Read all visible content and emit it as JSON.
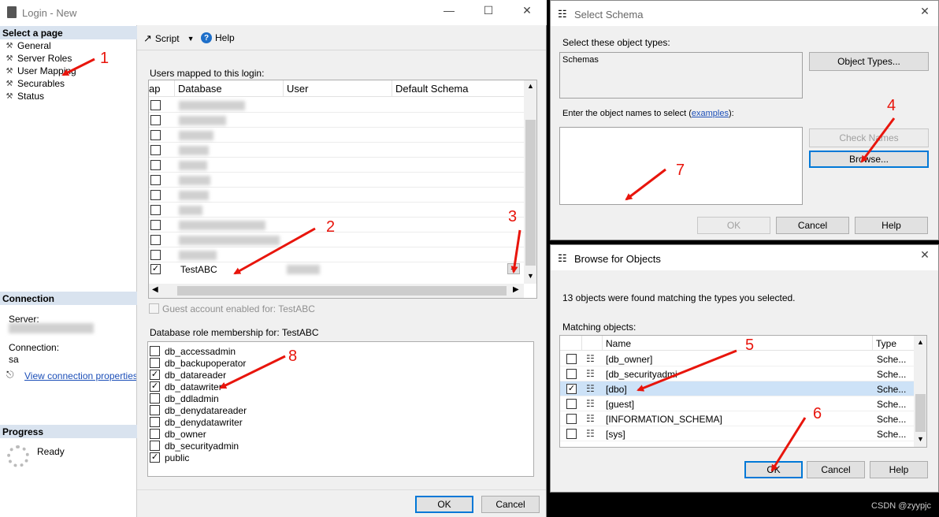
{
  "login": {
    "title": "Login - New",
    "pages_header": "Select a page",
    "pages": [
      "General",
      "Server Roles",
      "User Mapping",
      "Securables",
      "Status"
    ],
    "connection_header": "Connection",
    "server_label": "Server:",
    "connection_label": "Connection:",
    "connection_value": "sa",
    "view_connection_link": "View connection properties",
    "progress_header": "Progress",
    "progress_status": "Ready",
    "toolbar": {
      "script": "Script",
      "help": "Help"
    },
    "users_mapped_label": "Users mapped to this login:",
    "mapping_columns": [
      "ap",
      "Database",
      "User",
      "Default Schema"
    ],
    "mapping_last_db": "TestABC",
    "guest_label": "Guest account enabled for: TestABC",
    "role_membership_label": "Database role membership for: TestABC",
    "roles": [
      {
        "name": "db_accessadmin",
        "checked": false
      },
      {
        "name": "db_backupoperator",
        "checked": false
      },
      {
        "name": "db_datareader",
        "checked": true
      },
      {
        "name": "db_datawriter",
        "checked": true
      },
      {
        "name": "db_ddladmin",
        "checked": false
      },
      {
        "name": "db_denydatareader",
        "checked": false
      },
      {
        "name": "db_denydatawriter",
        "checked": false
      },
      {
        "name": "db_owner",
        "checked": false
      },
      {
        "name": "db_securityadmin",
        "checked": false
      },
      {
        "name": "public",
        "checked": true
      }
    ],
    "ok": "OK",
    "cancel": "Cancel",
    "ellipsis_button": "..."
  },
  "schema_dialog": {
    "title": "Select Schema",
    "object_types_label": "Select these object types:",
    "object_types_value": "Schemas",
    "object_types_button": "Object Types...",
    "enter_names_label": "Enter the object names to select (",
    "examples_link": "examples",
    "enter_names_suffix": "):",
    "check_names_button": "Check Names",
    "browse_button": "Browse...",
    "ok": "OK",
    "cancel": "Cancel",
    "help": "Help"
  },
  "browse_dialog": {
    "title": "Browse for Objects",
    "found_text": "13 objects were found matching the types you selected.",
    "matching_label": "Matching objects:",
    "columns": [
      "Name",
      "Type"
    ],
    "rows": [
      {
        "name": "[db_owner]",
        "type": "Sche...",
        "checked": false
      },
      {
        "name": "[db_securityadmi",
        "type": "Sche...",
        "checked": false
      },
      {
        "name": "[dbo]",
        "type": "Sche...",
        "checked": true
      },
      {
        "name": "[guest]",
        "type": "Sche...",
        "checked": false
      },
      {
        "name": "[INFORMATION_SCHEMA]",
        "type": "Sche...",
        "checked": false
      },
      {
        "name": "[sys]",
        "type": "Sche...",
        "checked": false
      }
    ],
    "ok": "OK",
    "cancel": "Cancel",
    "help": "Help"
  },
  "annotations": [
    "1",
    "2",
    "3",
    "4",
    "5",
    "6",
    "7",
    "8"
  ],
  "watermark": "CSDN @zyypjc",
  "colors": {
    "arrow": "#e8150c",
    "accent": "#0078d7",
    "selection": "#cde2f7"
  }
}
